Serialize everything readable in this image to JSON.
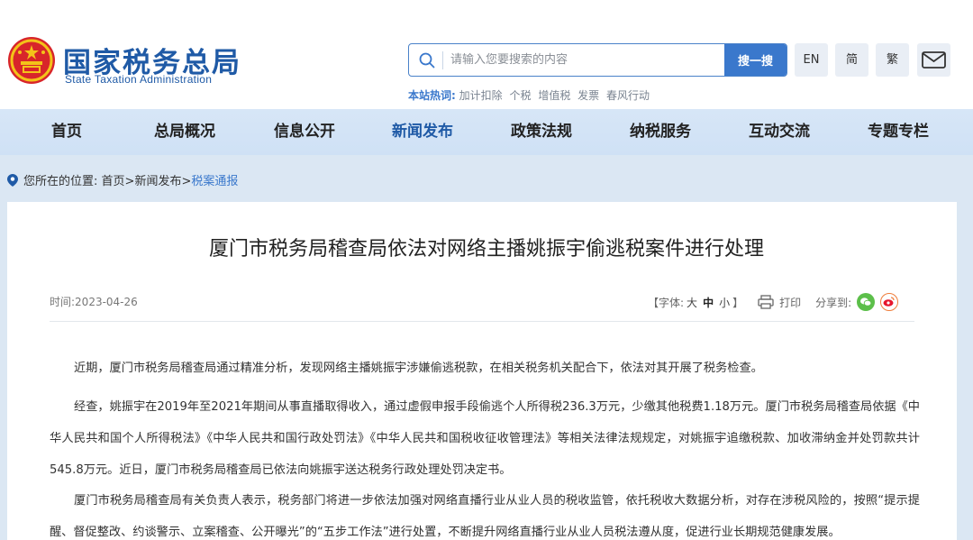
{
  "header": {
    "logo_cn": "国家税务总局",
    "logo_en": "State Taxation Administration",
    "search": {
      "placeholder": "请输入您要搜索的内容",
      "button": "搜一搜"
    },
    "hot": {
      "label": "本站热词:",
      "items": [
        "加计扣除",
        "个税",
        "增值税",
        "发票",
        "春风行动"
      ]
    },
    "lang": {
      "en": "EN",
      "simplified": "简",
      "traditional": "繁"
    }
  },
  "nav": {
    "items": [
      "首页",
      "总局概况",
      "信息公开",
      "新闻发布",
      "政策法规",
      "纳税服务",
      "互动交流",
      "专题专栏"
    ],
    "active_index": 3
  },
  "breadcrumb": {
    "prefix": "您所在的位置:",
    "home": "首页",
    "sep1": ">",
    "section": "新闻发布",
    "sep2": ">",
    "current": "税案通报"
  },
  "article": {
    "title": "厦门市税务局稽查局依法对网络主播姚振宇偷逃税案件进行处理",
    "time": "时间:2023-04-26",
    "font_size": {
      "label": "【字体:",
      "large": "大",
      "medium": "中",
      "small": "小",
      "close": "】"
    },
    "print": "打印",
    "share": "分享到:",
    "paragraphs": [
      "近期，厦门市税务局稽查局通过精准分析，发现网络主播姚振宇涉嫌偷逃税款，在相关税务机关配合下，依法对其开展了税务检查。",
      "经查，姚振宇在2019年至2021年期间从事直播取得收入，通过虚假申报手段偷逃个人所得税236.3万元，少缴其他税费1.18万元。厦门市税务局稽查局依据《中华人民共和国个人所得税法》《中华人民共和国行政处罚法》《中华人民共和国税收征收管理法》等相关法律法规规定，对姚振宇追缴税款、加收滞纳金并处罚款共计545.8万元。近日，厦门市税务局稽查局已依法向姚振宇送达税务行政处理处罚决定书。",
      "厦门市税务局稽查局有关负责人表示，税务部门将进一步依法加强对网络直播行业从业人员的税收监管，依托税收大数据分析，对存在涉税风险的，按照“提示提醒、督促整改、约谈警示、立案稽查、公开曝光”的“五步工作法”进行处置，不断提升网络直播行业从业人员税法遵从度，促进行业长期规范健康发展。"
    ]
  },
  "colors": {
    "brand_blue": "#1f5aa6",
    "accent_blue": "#3a78cc",
    "nav_bg": "#d7e6f7",
    "page_bg": "#dbe7f3",
    "wechat_green": "#5cbf4a",
    "weibo_orange": "#ef7d3b"
  }
}
